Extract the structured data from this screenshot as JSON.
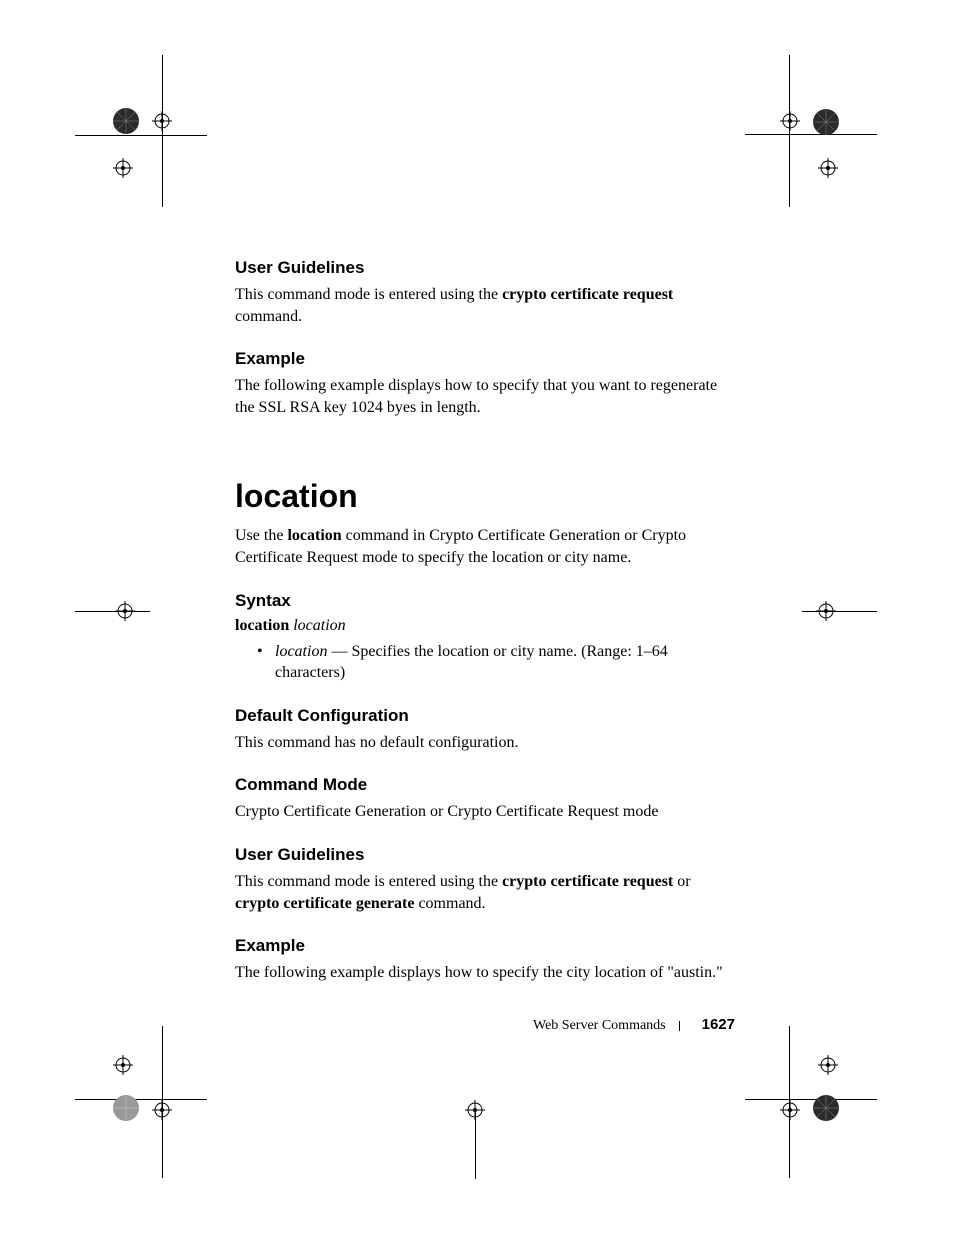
{
  "sec1": {
    "heading": "User Guidelines",
    "p_a": "This command mode is entered using the ",
    "p_bold": "crypto certificate request",
    "p_b": " command."
  },
  "sec2": {
    "heading": "Example",
    "p": "The following example displays how to specify that you want to regenerate the SSL RSA key 1024 byes in length."
  },
  "title": "location",
  "intro_a": "Use the ",
  "intro_bold": "location",
  "intro_b": " command in Crypto Certificate Generation or Crypto Certificate Request mode to specify the location or city name.",
  "syntax": {
    "heading": "Syntax",
    "keyword": "location",
    "arg": "location",
    "bullet_arg": "location",
    "bullet_rest": " — Specifies the location or city name. (Range: 1–64 characters)"
  },
  "defcfg": {
    "heading": "Default Configuration",
    "p": "This command has no default configuration."
  },
  "cmdmode": {
    "heading": "Command Mode",
    "p": "Crypto Certificate Generation or Crypto Certificate Request mode"
  },
  "ug2": {
    "heading": "User Guidelines",
    "p_a": "This command mode is entered using the ",
    "p_b1": "crypto certificate request",
    "p_mid": " or ",
    "p_b2": "crypto certificate generate",
    "p_c": " command."
  },
  "ex2": {
    "heading": "Example",
    "p": "The following example displays how to specify the city location of \"austin.\""
  },
  "footer": {
    "section": "Web Server Commands",
    "page": "1627"
  }
}
